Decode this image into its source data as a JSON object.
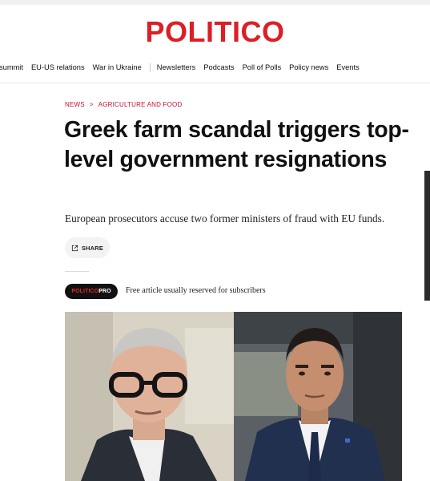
{
  "brand": {
    "logo_text": "POLITICO",
    "accent_color": "#dc1f26"
  },
  "nav": {
    "items": [
      "summit",
      "EU-US relations",
      "War in Ukraine"
    ],
    "items_secondary": [
      "Newsletters",
      "Podcasts",
      "Poll of Polls",
      "Policy news",
      "Events"
    ]
  },
  "article": {
    "breadcrumb": {
      "section": "NEWS",
      "separator": ">",
      "subsection": "AGRICULTURE AND FOOD"
    },
    "headline": "Greek farm scandal triggers top-level government resignations",
    "dek": "European prosecutors accuse two former ministers of fraud with EU funds.",
    "share_label": "SHARE",
    "pro_badge": {
      "part1": "POLITICO",
      "part2": "PRO"
    },
    "pro_note": "Free article usually reserved for subscribers"
  },
  "icons": {
    "share": "share-icon"
  }
}
